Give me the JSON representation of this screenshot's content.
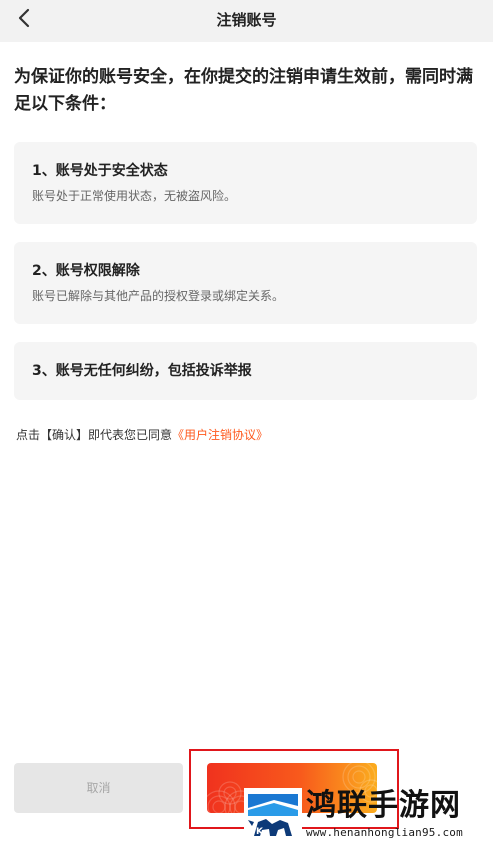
{
  "navbar": {
    "back_icon": "chevron-left-icon",
    "title": "注销账号"
  },
  "intro": {
    "text": "为保证你的账号安全，在你提交的注销申请生效前，需同时满足以下条件："
  },
  "conditions": [
    {
      "title": "1、账号处于安全状态",
      "desc": "账号处于正常使用状态，无被盗风险。"
    },
    {
      "title": "2、账号权限解除",
      "desc": "账号已解除与其他产品的授权登录或绑定关系。"
    },
    {
      "title": "3、账号无任何纠纷，包括投诉举报",
      "desc": ""
    }
  ],
  "agreement": {
    "prefix": "点击【确认】即代表您已同意",
    "link": "《用户注销协议》"
  },
  "buttons": {
    "cancel": "取消",
    "confirm": ""
  },
  "watermark": {
    "title": "鸿联手游网",
    "url": "www.henanhonglian95.com"
  },
  "colors": {
    "accent": "#ff5a1f",
    "confirm_gradient_start": "#f0321e",
    "confirm_gradient_end": "#fbad1e",
    "highlight": "#e0161b",
    "card_bg": "#f5f5f5",
    "navbar_bg": "#f2f2f2"
  }
}
